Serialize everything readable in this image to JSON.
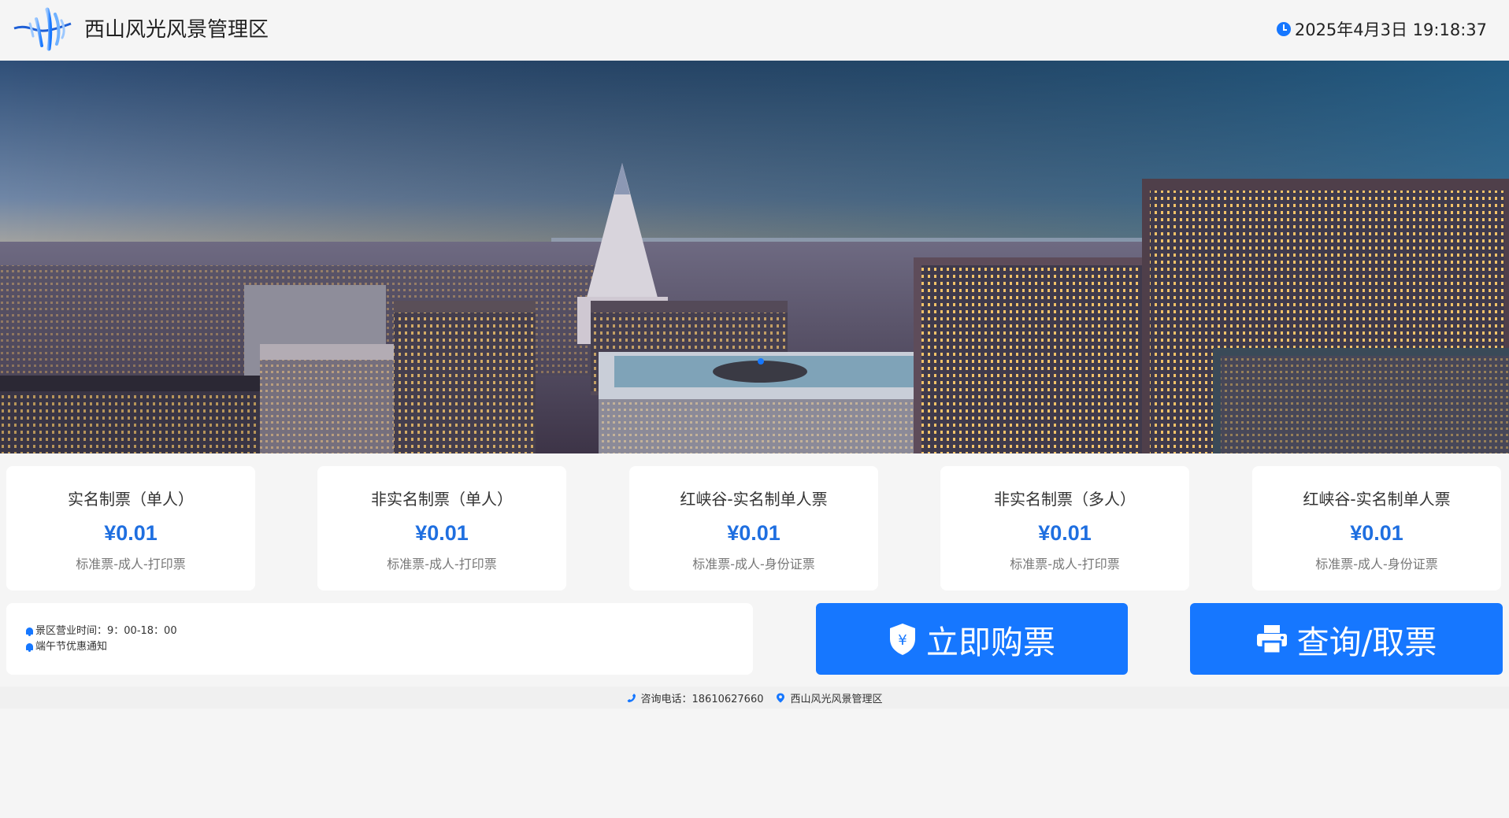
{
  "header": {
    "title": "西山风光风景管理区",
    "datetime": "2025年4月3日 19:18:37"
  },
  "banner": {
    "image": "city-skyline-at-dusk",
    "slide_count": 1,
    "active_slide": 1
  },
  "tickets": [
    {
      "name": "实名制票（单人）",
      "price": "¥0.01",
      "desc": "标准票-成人-打印票"
    },
    {
      "name": "非实名制票（单人）",
      "price": "¥0.01",
      "desc": "标准票-成人-打印票"
    },
    {
      "name": "红峡谷-实名制单人票",
      "price": "¥0.01",
      "desc": "标准票-成人-身份证票"
    },
    {
      "name": "非实名制票（多人）",
      "price": "¥0.01",
      "desc": "标准票-成人-打印票"
    },
    {
      "name": "红峡谷-实名制单人票",
      "price": "¥0.01",
      "desc": "标准票-成人-身份证票"
    }
  ],
  "notices": [
    {
      "text": "景区营业时间：9：00-18：00",
      "icon": "bell-icon"
    },
    {
      "text": "端午节优惠通知",
      "icon": "bell-icon"
    }
  ],
  "actions": {
    "buy_label": "立即购票",
    "buy_icon": "shield-yen-icon",
    "query_label": "查询/取票",
    "query_icon": "printer-icon"
  },
  "footer": {
    "phone_label": "咨询电话：18610627660",
    "address_label": "西山风光风景管理区"
  },
  "colors": {
    "accent": "#1677ff",
    "price": "#1f6fe0",
    "background": "#f5f5f5"
  }
}
